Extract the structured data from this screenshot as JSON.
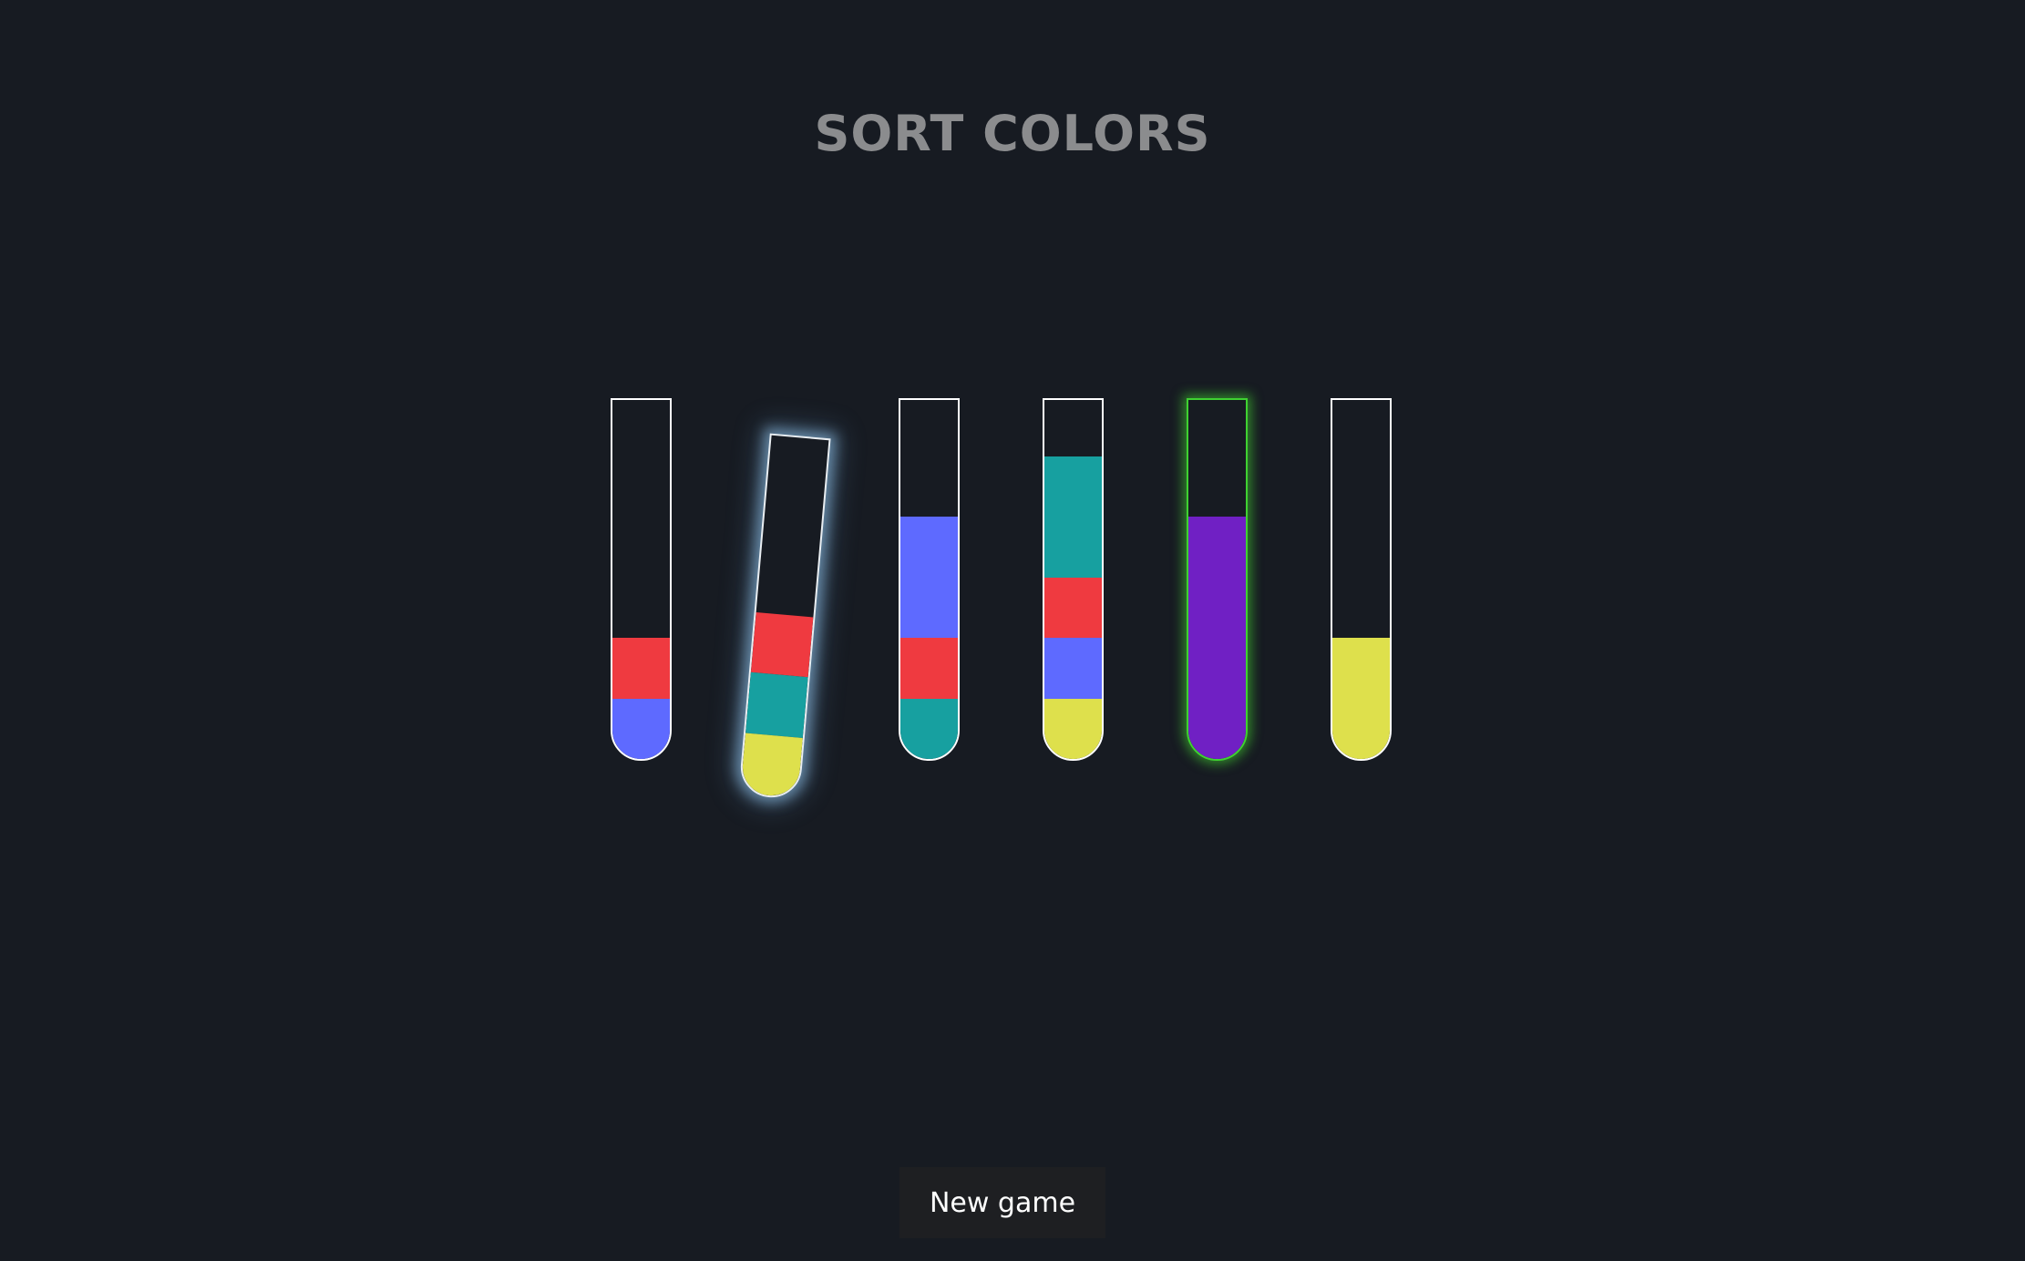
{
  "title": "SORT COLORS",
  "colors": {
    "red": "#ef3a40",
    "blue": "#5e6aff",
    "teal": "#17a0a0",
    "yellow": "#dee04c",
    "purple": "#7020c4",
    "background": "#171b22",
    "selected_glow": "#96c8f0",
    "solved_glow": "#3fd231"
  },
  "capacity": 6,
  "tubes": [
    {
      "layers": [
        "blue",
        "red"
      ],
      "selected": false,
      "solved": false
    },
    {
      "layers": [
        "yellow",
        "teal",
        "red"
      ],
      "selected": true,
      "solved": false
    },
    {
      "layers": [
        "teal",
        "red",
        "blue",
        "blue"
      ],
      "selected": false,
      "solved": false
    },
    {
      "layers": [
        "yellow",
        "blue",
        "red",
        "teal",
        "teal"
      ],
      "selected": false,
      "solved": false
    },
    {
      "layers": [
        "purple",
        "purple",
        "purple",
        "purple"
      ],
      "selected": false,
      "solved": true
    },
    {
      "layers": [
        "yellow",
        "yellow"
      ],
      "selected": false,
      "solved": false
    }
  ],
  "new_game_label": "New game"
}
